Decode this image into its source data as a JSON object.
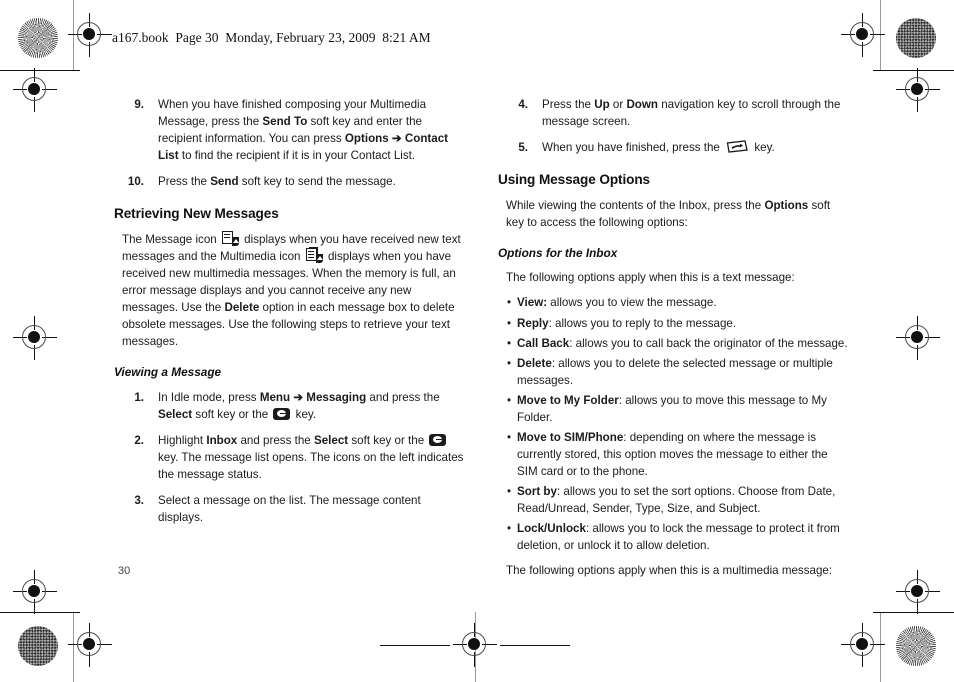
{
  "document": {
    "running_header": "a167.book  Page 30  Monday, February 23, 2009  8:21 AM",
    "folio": "30"
  },
  "left_column": {
    "steps_continued": [
      {
        "num": "9.",
        "segments": [
          {
            "t": "When you have finished composing your Multimedia Message, press the ",
            "b": false
          },
          {
            "t": "Send To",
            "b": true
          },
          {
            "t": " soft key and enter the recipient information. You can press ",
            "b": false
          },
          {
            "t": "Options",
            "b": true
          },
          {
            "t": " ➔ ",
            "b": true
          },
          {
            "t": "Contact List",
            "b": true
          },
          {
            "t": " to find the recipient if it is in your Contact List.",
            "b": false
          }
        ]
      },
      {
        "num": "10.",
        "segments": [
          {
            "t": "Press the ",
            "b": false
          },
          {
            "t": "Send",
            "b": true
          },
          {
            "t": " soft key to send the message.",
            "b": false
          }
        ]
      }
    ],
    "section_heading": "Retrieving New Messages",
    "intro_segments": [
      {
        "t": "The Message icon ",
        "b": false
      },
      {
        "icon": "message-icon"
      },
      {
        "t": " displays when you have received new text messages and the Multimedia icon ",
        "b": false
      },
      {
        "icon": "multimedia-icon"
      },
      {
        "t": " displays when you have received new multimedia messages. When the memory is full, an error message displays and you cannot receive any new messages. Use the ",
        "b": false
      },
      {
        "t": "Delete",
        "b": true
      },
      {
        "t": " option in each message box to delete obsolete messages. Use the following steps to retrieve your text messages.",
        "b": false
      }
    ],
    "sub_heading": "Viewing a Message",
    "viewing_steps": [
      {
        "num": "1.",
        "segments": [
          {
            "t": "In Idle mode, press ",
            "b": false
          },
          {
            "t": "Menu",
            "b": true
          },
          {
            "t": " ➔ ",
            "b": true
          },
          {
            "t": "Messaging",
            "b": true
          },
          {
            "t": " and press the ",
            "b": false
          },
          {
            "t": "Select",
            "b": true
          },
          {
            "t": " soft key or the ",
            "b": false
          },
          {
            "icon": "ok-key-icon"
          },
          {
            "t": " key.",
            "b": false
          }
        ]
      },
      {
        "num": "2.",
        "segments": [
          {
            "t": "Highlight ",
            "b": false
          },
          {
            "t": "Inbox",
            "b": true
          },
          {
            "t": " and press the ",
            "b": false
          },
          {
            "t": "Select",
            "b": true
          },
          {
            "t": " soft key or the ",
            "b": false
          },
          {
            "icon": "ok-key-icon"
          },
          {
            "t": " key. The message list opens. The icons on the left indicates the message status.",
            "b": false
          }
        ]
      },
      {
        "num": "3.",
        "segments": [
          {
            "t": "Select a message on the list. The message content displays.",
            "b": false
          }
        ]
      }
    ]
  },
  "right_column": {
    "steps_continued": [
      {
        "num": "4.",
        "segments": [
          {
            "t": "Press the ",
            "b": false
          },
          {
            "t": "Up",
            "b": true
          },
          {
            "t": " or ",
            "b": false
          },
          {
            "t": "Down",
            "b": true
          },
          {
            "t": " navigation key to scroll through the message screen.",
            "b": false
          }
        ]
      },
      {
        "num": "5.",
        "segments": [
          {
            "t": "When you have finished, press the ",
            "b": false
          },
          {
            "icon": "end-key-icon"
          },
          {
            "t": " key.",
            "b": false
          }
        ]
      }
    ],
    "section_heading": "Using Message Options",
    "intro_segments": [
      {
        "t": "While viewing the contents of the Inbox, press the ",
        "b": false
      },
      {
        "t": "Options",
        "b": true
      },
      {
        "t": " soft key to access the following options:",
        "b": false
      }
    ],
    "sub_heading": "Options for the Inbox",
    "text_message_lead": "The following options apply when this is a text message:",
    "options": [
      {
        "segments": [
          {
            "t": "View:",
            "b": true
          },
          {
            "t": " allows you to view the message.",
            "b": false
          }
        ]
      },
      {
        "segments": [
          {
            "t": "Reply",
            "b": true
          },
          {
            "t": ": allows you to reply to the message.",
            "b": false
          }
        ]
      },
      {
        "segments": [
          {
            "t": "Call Back",
            "b": true
          },
          {
            "t": ": allows you to call back the originator of the message.",
            "b": false
          }
        ]
      },
      {
        "segments": [
          {
            "t": "Delete",
            "b": true
          },
          {
            "t": ": allows you to delete the selected message or multiple messages.",
            "b": false
          }
        ]
      },
      {
        "segments": [
          {
            "t": "Move to My Folder",
            "b": true
          },
          {
            "t": ": allows you to move this message to My Folder.",
            "b": false
          }
        ]
      },
      {
        "segments": [
          {
            "t": "Move to SIM/Phone",
            "b": true
          },
          {
            "t": ": depending on where the message is currently stored, this option moves the message to either the SIM card or to the phone.",
            "b": false
          }
        ]
      },
      {
        "segments": [
          {
            "t": "Sort by",
            "b": true
          },
          {
            "t": ": allows you to set the sort options. Choose from Date, Read/Unread, Sender, Type, Size, and Subject.",
            "b": false
          }
        ]
      },
      {
        "segments": [
          {
            "t": "Lock/Unlock",
            "b": true
          },
          {
            "t": ": allows you to lock the message to protect it from deletion, or unlock it to allow deletion.",
            "b": false
          }
        ]
      }
    ],
    "bullet_char": "•",
    "multimedia_lead": "The following options apply when this is a multimedia message:"
  },
  "printers_marks": {
    "registration_icon": "registration-target-icon",
    "rosette_icon": "color-rosette-icon"
  }
}
